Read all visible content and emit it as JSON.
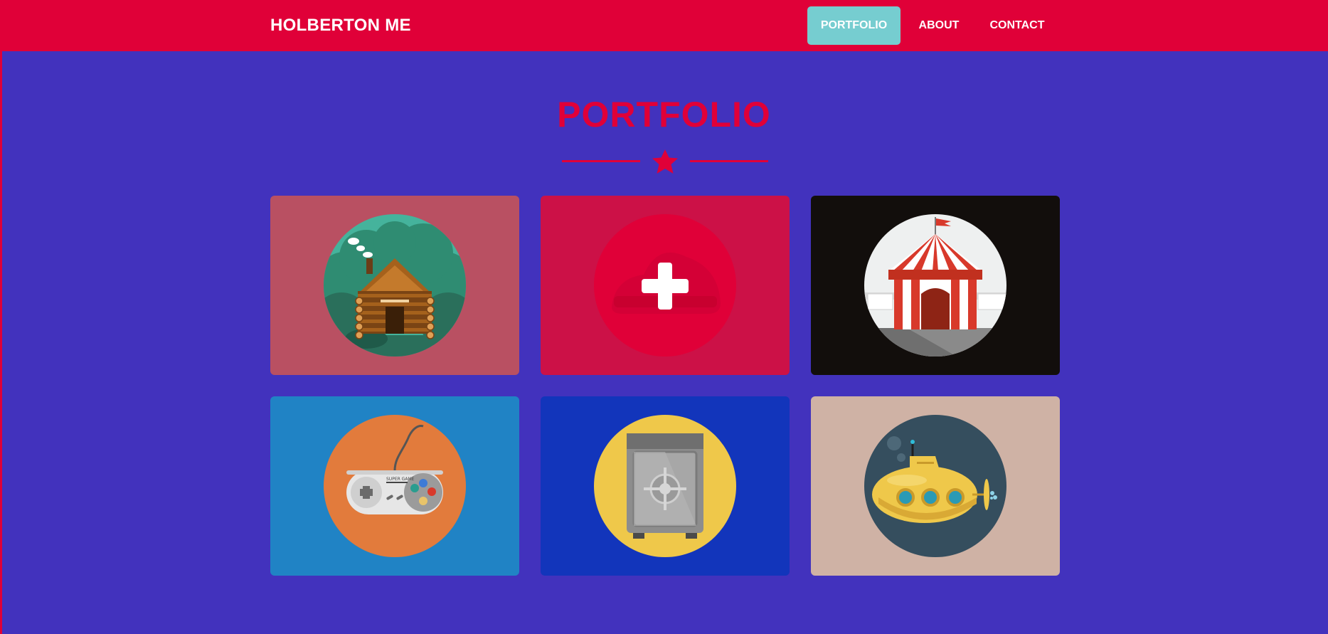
{
  "navbar": {
    "brand": "HOLBERTON ME",
    "items": [
      {
        "label": "PORTFOLIO",
        "active": true
      },
      {
        "label": "ABOUT",
        "active": false
      },
      {
        "label": "CONTACT",
        "active": false
      }
    ]
  },
  "portfolio": {
    "title": "PORTFOLIO",
    "divider_icon": "star-icon",
    "items": [
      {
        "icon": "log-cabin-icon",
        "background": "#b95062"
      },
      {
        "icon": "plus-icon",
        "background": "#cc1147",
        "hovered": true
      },
      {
        "icon": "circus-tent-icon",
        "background": "#120e0c"
      },
      {
        "icon": "game-controller-icon",
        "background": "#2083c5",
        "controller_label": "SUPER GAME"
      },
      {
        "icon": "safe-icon",
        "background": "#1235bb"
      },
      {
        "icon": "submarine-icon",
        "background": "#cfb2a5"
      }
    ]
  },
  "colors": {
    "primary": "#e00038",
    "background": "#4232bd",
    "active_nav": "#76cdd0",
    "text_light": "#ffffff"
  }
}
